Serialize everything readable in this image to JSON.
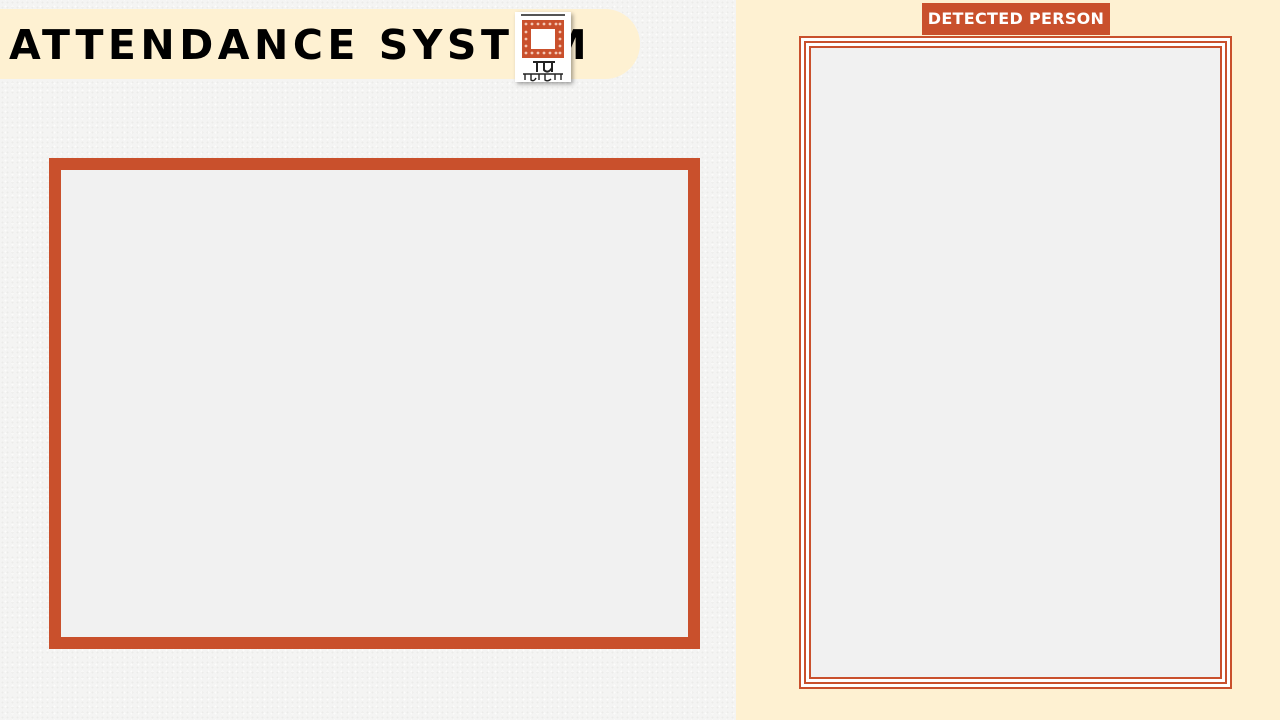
{
  "header": {
    "title": "ATTENDANCE SYSTEM",
    "logo_icon": "university-logo-icon"
  },
  "camera": {
    "frame_color": "#c9502c",
    "feed_color": "#f1f1f1"
  },
  "detected_panel": {
    "label": "DETECTED PERSON",
    "background": "#fef1d2",
    "accent": "#c9502c"
  },
  "colors": {
    "accent": "#c9502c",
    "panel": "#fef1d2",
    "title_text": "#000000"
  }
}
